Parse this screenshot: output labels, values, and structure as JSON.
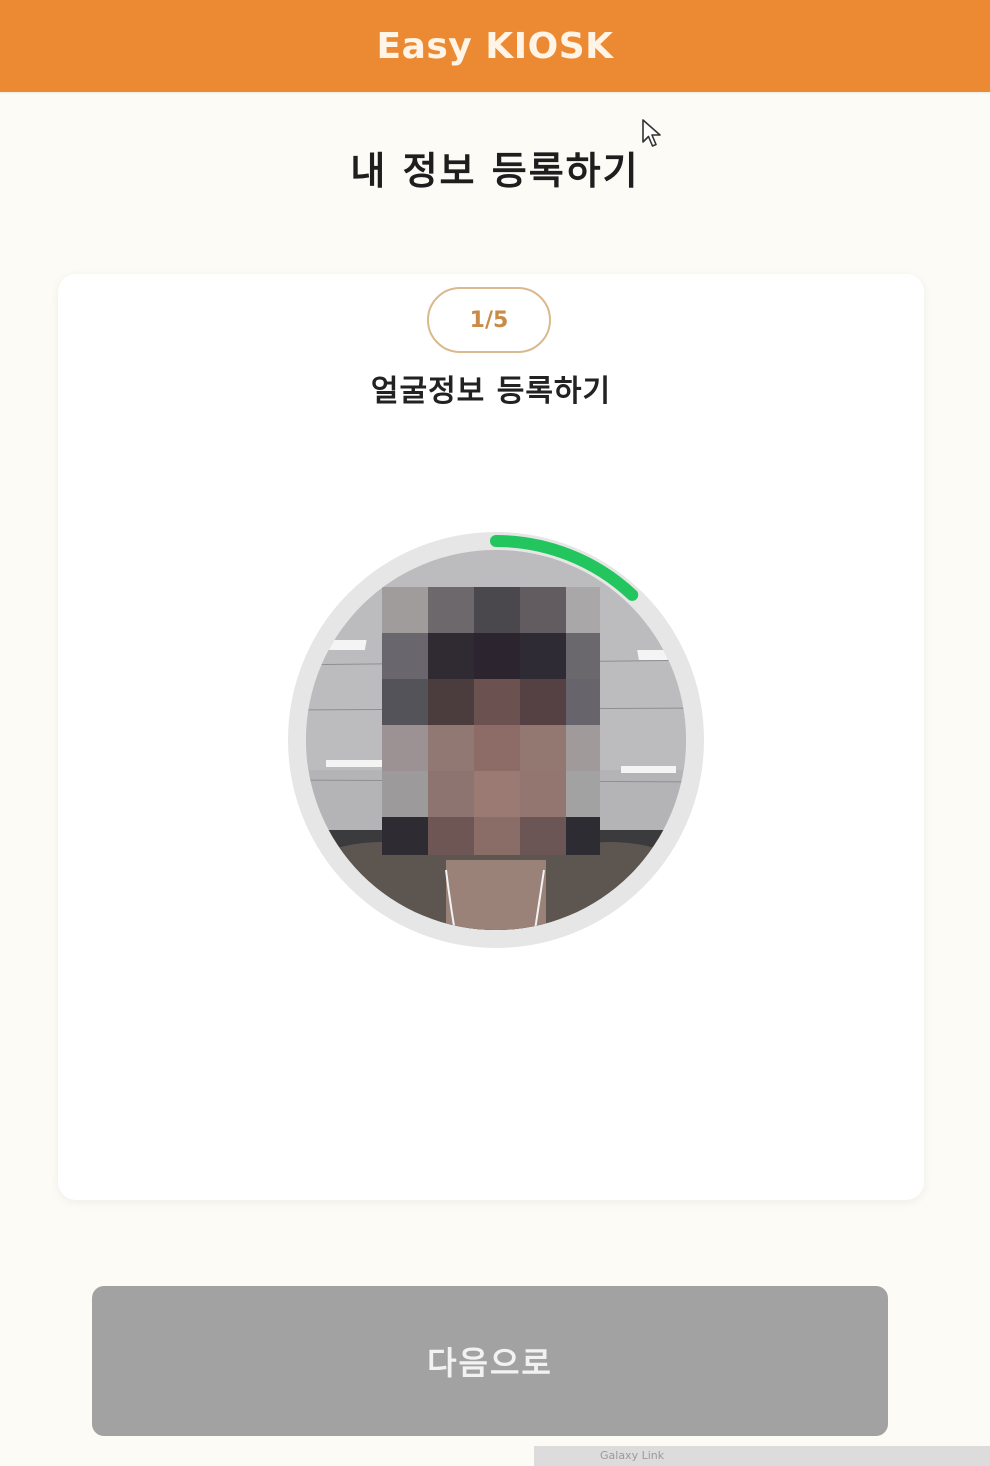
{
  "header": {
    "title": "Easy KIOSK",
    "background_color": "#ec8a34"
  },
  "page": {
    "title": "내 정보 등록하기"
  },
  "registration": {
    "step_indicator": "1/5",
    "step_title": "얼굴정보 등록하기",
    "scan_progress": 0.12,
    "progress_color": "#22c55e",
    "camera_preview": "face-camera-preview (pixelated face)"
  },
  "actions": {
    "next_label": "다음으로",
    "next_button_color": "#a2a2a2"
  },
  "overlay": {
    "taskbar_text": "Galaxy Link"
  },
  "icons": {
    "cursor": "mouse-pointer-icon"
  }
}
